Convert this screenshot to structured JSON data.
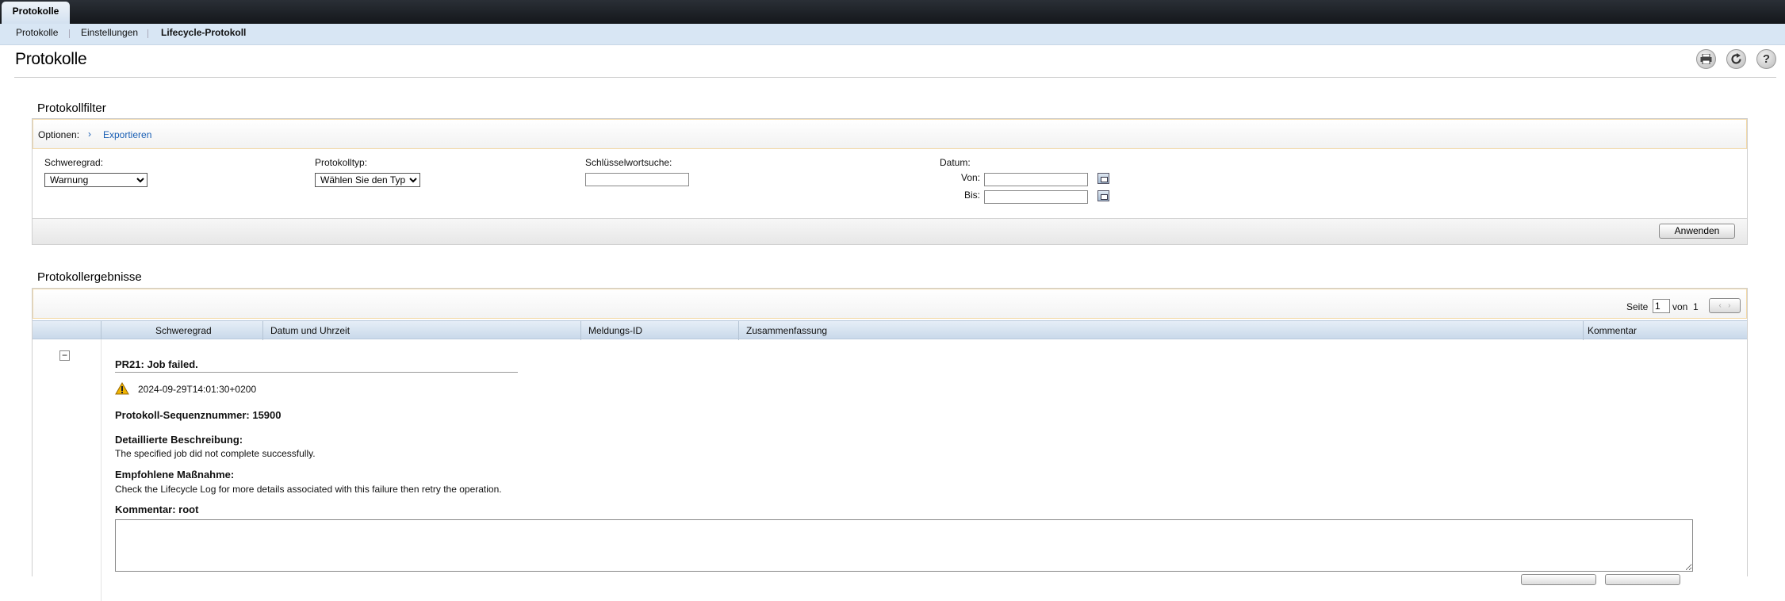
{
  "top_tab": "Protokolle",
  "subnav": [
    "Protokolle",
    "Einstellungen",
    "Lifecycle-Protokoll"
  ],
  "page_title": "Protokolle",
  "toolbar_icons": [
    "print-icon",
    "refresh-icon",
    "help-icon"
  ],
  "filter": {
    "title": "Protokollfilter",
    "options_label": "Optionen:",
    "export_link": "Exportieren",
    "severity_label": "Schweregrad:",
    "severity_value": "Warnung",
    "type_label": "Protokolltyp:",
    "type_value": "Wählen Sie den Typ",
    "keyword_label": "Schlüsselwortsuche:",
    "keyword_value": "",
    "date_label": "Datum:",
    "from_label": "Von:",
    "to_label": "Bis:",
    "apply_button": "Anwenden"
  },
  "results": {
    "title": "Protokollergebnisse",
    "page_label": "Seite",
    "page_value": "1",
    "of_label": "von",
    "total_pages": "1",
    "columns": [
      "Schweregrad",
      "Datum und Uhrzeit",
      "Meldungs-ID",
      "Zusammenfassung",
      "Kommentar"
    ],
    "entry": {
      "collapse": "−",
      "heading": "PR21: Job failed.",
      "timestamp": "2024-09-29T14:01:30+0200",
      "sequence": "Protokoll-Sequenznummer: 15900",
      "desc_label": "Detaillierte Beschreibung:",
      "desc_text": "The specified job did not complete successfully.",
      "action_label": "Empfohlene Maßnahme:",
      "action_text": "Check the Lifecycle Log for more details associated with this failure then retry the operation.",
      "comment_label": "Kommentar: root",
      "comment_value": ""
    }
  },
  "colors": {
    "topbar": "#1b1f24",
    "subnav": "#d8e6f4",
    "link": "#1a5fb4",
    "warning": "#f0b400"
  }
}
